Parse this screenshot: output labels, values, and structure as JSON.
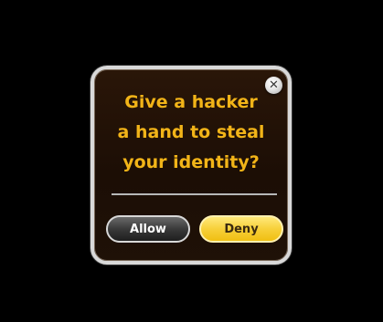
{
  "dialog": {
    "message_lines": [
      "Give a hacker",
      "a hand to steal",
      "your identity?"
    ],
    "close_label": "✕",
    "allow_label": "Allow",
    "deny_label": "Deny"
  },
  "colors": {
    "background": "#000000",
    "dialog_bg": "#1f1107",
    "dialog_border": "#d9d9d9",
    "message_text": "#f2b418",
    "deny_button": "#f7d03a",
    "allow_button": "#3a3a3a"
  },
  "icons": {
    "close": "close-icon"
  }
}
